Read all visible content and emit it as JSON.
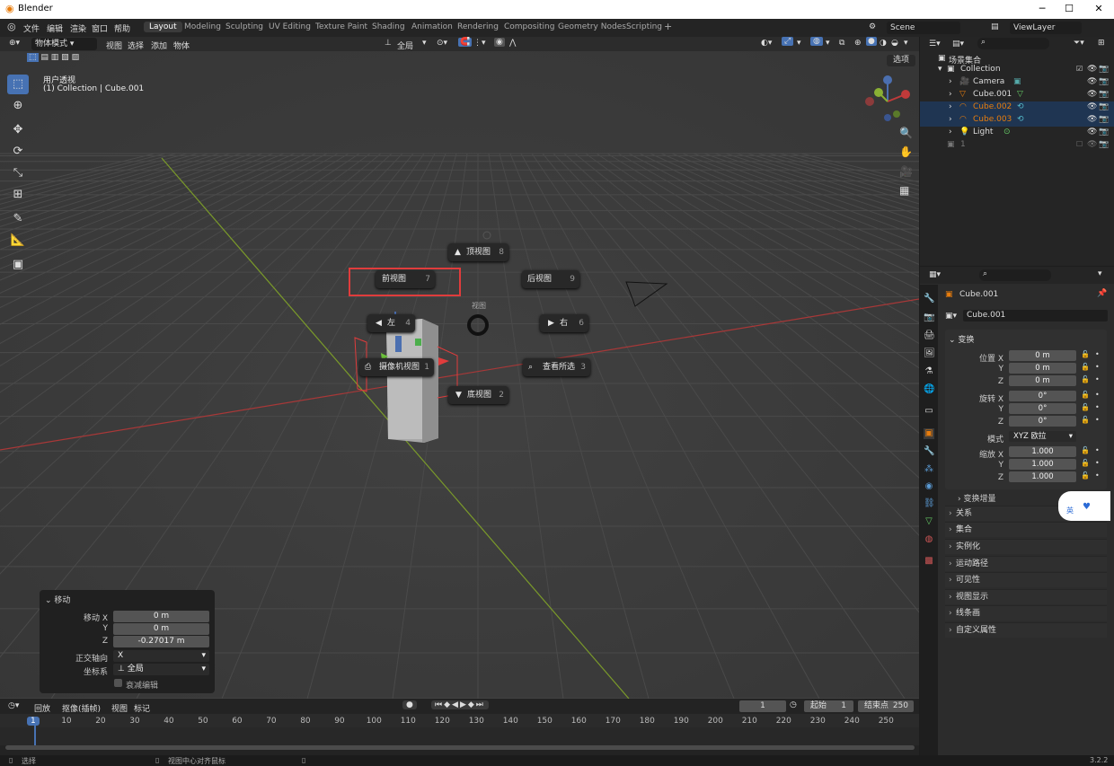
{
  "window": {
    "title": "Blender",
    "version": "3.2.2"
  },
  "menus": [
    "文件",
    "编辑",
    "渲染",
    "窗口",
    "帮助"
  ],
  "workspaces": [
    "Layout",
    "Modeling",
    "Sculpting",
    "UV Editing",
    "Texture Paint",
    "Shading",
    "Animation",
    "Rendering",
    "Compositing",
    "Geometry Nodes",
    "Scripting"
  ],
  "active_workspace": "Layout",
  "scene": "Scene",
  "view_layer": "ViewLayer",
  "viewport": {
    "mode": "物体模式",
    "header_menus": [
      "视图",
      "选择",
      "添加",
      "物体"
    ],
    "transform_orientation": "全局",
    "options_label": "选项",
    "overlay_title": "用户透视",
    "overlay_subtitle": "(1) Collection | Cube.001"
  },
  "pie_menu": {
    "title": "视图",
    "items": [
      {
        "label": "顶视图",
        "key": "8"
      },
      {
        "label": "前视图",
        "key": "7"
      },
      {
        "label": "后视图",
        "key": "9"
      },
      {
        "label": "左",
        "key": "4"
      },
      {
        "label": "右",
        "key": "6"
      },
      {
        "label": "摄像机视图",
        "key": "1"
      },
      {
        "label": "查看所选",
        "key": "3"
      },
      {
        "label": "底视图",
        "key": "2"
      }
    ]
  },
  "redo_panel": {
    "title": "移动",
    "move_x_label": "移动 X",
    "move_x": "0 m",
    "move_y_label": "Y",
    "move_y": "0 m",
    "move_z_label": "Z",
    "move_z": "-0.27017 m",
    "axis_label": "正交轴向",
    "axis_value": "X",
    "orient_label": "坐标系",
    "orient_value": "全局",
    "proportional_label": "衰减编辑"
  },
  "timeline": {
    "menus": [
      "回放",
      "抠像(插帧)",
      "视图",
      "标记"
    ],
    "current_frame": "1",
    "start_label": "起始",
    "start": "1",
    "end_label": "结束点",
    "end": "250",
    "ticks": [
      "1",
      "10",
      "20",
      "30",
      "40",
      "50",
      "60",
      "70",
      "80",
      "90",
      "100",
      "110",
      "120",
      "130",
      "140",
      "150",
      "160",
      "170",
      "180",
      "190",
      "200",
      "210",
      "220",
      "230",
      "240",
      "250"
    ]
  },
  "outliner": {
    "root": "场景集合",
    "items": [
      {
        "label": "Collection",
        "selected": false
      },
      {
        "label": "Camera",
        "selected": false
      },
      {
        "label": "Cube.001",
        "selected": false
      },
      {
        "label": "Cube.002",
        "selected": true
      },
      {
        "label": "Cube.003",
        "selected": true
      },
      {
        "label": "Light",
        "selected": false
      },
      {
        "label": "1",
        "selected": false
      }
    ]
  },
  "properties": {
    "object_name": "Cube.001",
    "data_name": "Cube.001",
    "transform_title": "变换",
    "loc_label": "位置 X",
    "loc_x": "0 m",
    "loc_y": "0 m",
    "loc_z": "0 m",
    "rot_label": "旋转 X",
    "rot_x": "0°",
    "rot_y": "0°",
    "rot_z": "0°",
    "mode_label": "模式",
    "mode_value": "XYZ 欧拉",
    "scale_label": "缩放 X",
    "scale_x": "1.000",
    "scale_y": "1.000",
    "scale_z": "1.000",
    "y_label": "Y",
    "z_label": "Z",
    "delta_label": "变换增量",
    "panels": [
      "关系",
      "集合",
      "实例化",
      "运动路径",
      "可见性",
      "视图显示",
      "线条画",
      "自定义属性"
    ]
  },
  "ime_badge": "英",
  "status_bar": {
    "left": "选择",
    "middle": "视图中心对齐鼠标"
  },
  "colors": {
    "accent": "#4772b3",
    "selection_outline": "#e03c3c",
    "x_axis": "#c03a3a",
    "y_axis": "#8ab034",
    "orange": "#e87d0d"
  }
}
